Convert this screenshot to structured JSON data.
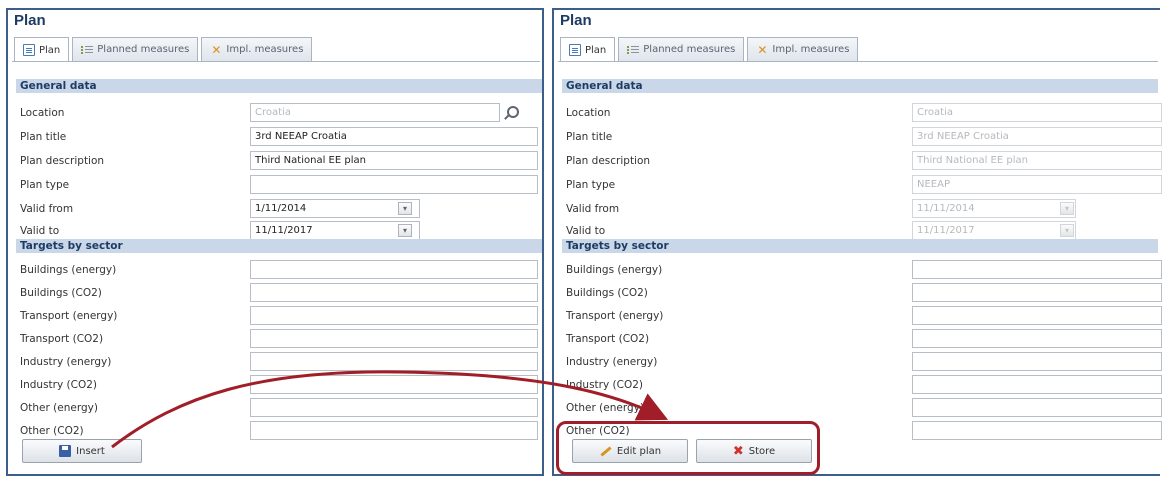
{
  "left_panel": {
    "title": "Plan",
    "tabs": [
      {
        "label": "Plan",
        "icon": "document-icon",
        "active": true
      },
      {
        "label": "Planned measures",
        "icon": "list-icon",
        "active": false
      },
      {
        "label": "Impl. measures",
        "icon": "tools-icon",
        "active": false
      }
    ],
    "general_header": "General data",
    "general_fields": [
      {
        "label": "Location",
        "value": "",
        "placeholder": "Croatia"
      },
      {
        "label": "Plan title",
        "value": "3rd NEEAP Croatia"
      },
      {
        "label": "Plan description",
        "value": "Third National EE plan"
      },
      {
        "label": "Plan type",
        "value": ""
      },
      {
        "label": "Valid from",
        "value": "1/11/2014"
      },
      {
        "label": "Valid to",
        "value": "11/11/2017"
      }
    ],
    "targets_header": "Targets by sector",
    "target_fields": [
      {
        "label": "Buildings (energy)",
        "value": ""
      },
      {
        "label": "Buildings (CO2)",
        "value": ""
      },
      {
        "label": "Transport (energy)",
        "value": ""
      },
      {
        "label": "Transport (CO2)",
        "value": ""
      },
      {
        "label": "Industry (energy)",
        "value": ""
      },
      {
        "label": "Industry (CO2)",
        "value": ""
      },
      {
        "label": "Other (energy)",
        "value": ""
      },
      {
        "label": "Other (CO2)",
        "value": ""
      }
    ],
    "insert_label": "Insert"
  },
  "right_panel": {
    "title": "Plan",
    "tabs": [
      {
        "label": "Plan",
        "icon": "document-icon",
        "active": true
      },
      {
        "label": "Planned measures",
        "icon": "list-icon",
        "active": false
      },
      {
        "label": "Impl. measures",
        "icon": "tools-icon",
        "active": false
      }
    ],
    "general_header": "General data",
    "general_fields": [
      {
        "label": "Location",
        "value": "Croatia"
      },
      {
        "label": "Plan title",
        "value": "3rd NEEAP Croatia"
      },
      {
        "label": "Plan description",
        "value": "Third National EE plan"
      },
      {
        "label": "Plan type",
        "value": "NEEAP"
      },
      {
        "label": "Valid from",
        "value": "11/11/2014"
      },
      {
        "label": "Valid to",
        "value": "11/11/2017"
      }
    ],
    "targets_header": "Targets by sector",
    "target_fields": [
      {
        "label": "Buildings (energy)",
        "value": ""
      },
      {
        "label": "Buildings (CO2)",
        "value": ""
      },
      {
        "label": "Transport (energy)",
        "value": ""
      },
      {
        "label": "Transport (CO2)",
        "value": ""
      },
      {
        "label": "Industry (energy)",
        "value": ""
      },
      {
        "label": "Industry (CO2)",
        "value": ""
      },
      {
        "label": "Other (energy)",
        "value": ""
      },
      {
        "label": "Other (CO2)",
        "value": ""
      }
    ],
    "edit_label": "Edit plan",
    "store_label": "Store"
  },
  "colors": {
    "panel_border": "#3b5f8a",
    "section_bg": "#c9d7e8",
    "annotation_red": "#a11e28"
  }
}
